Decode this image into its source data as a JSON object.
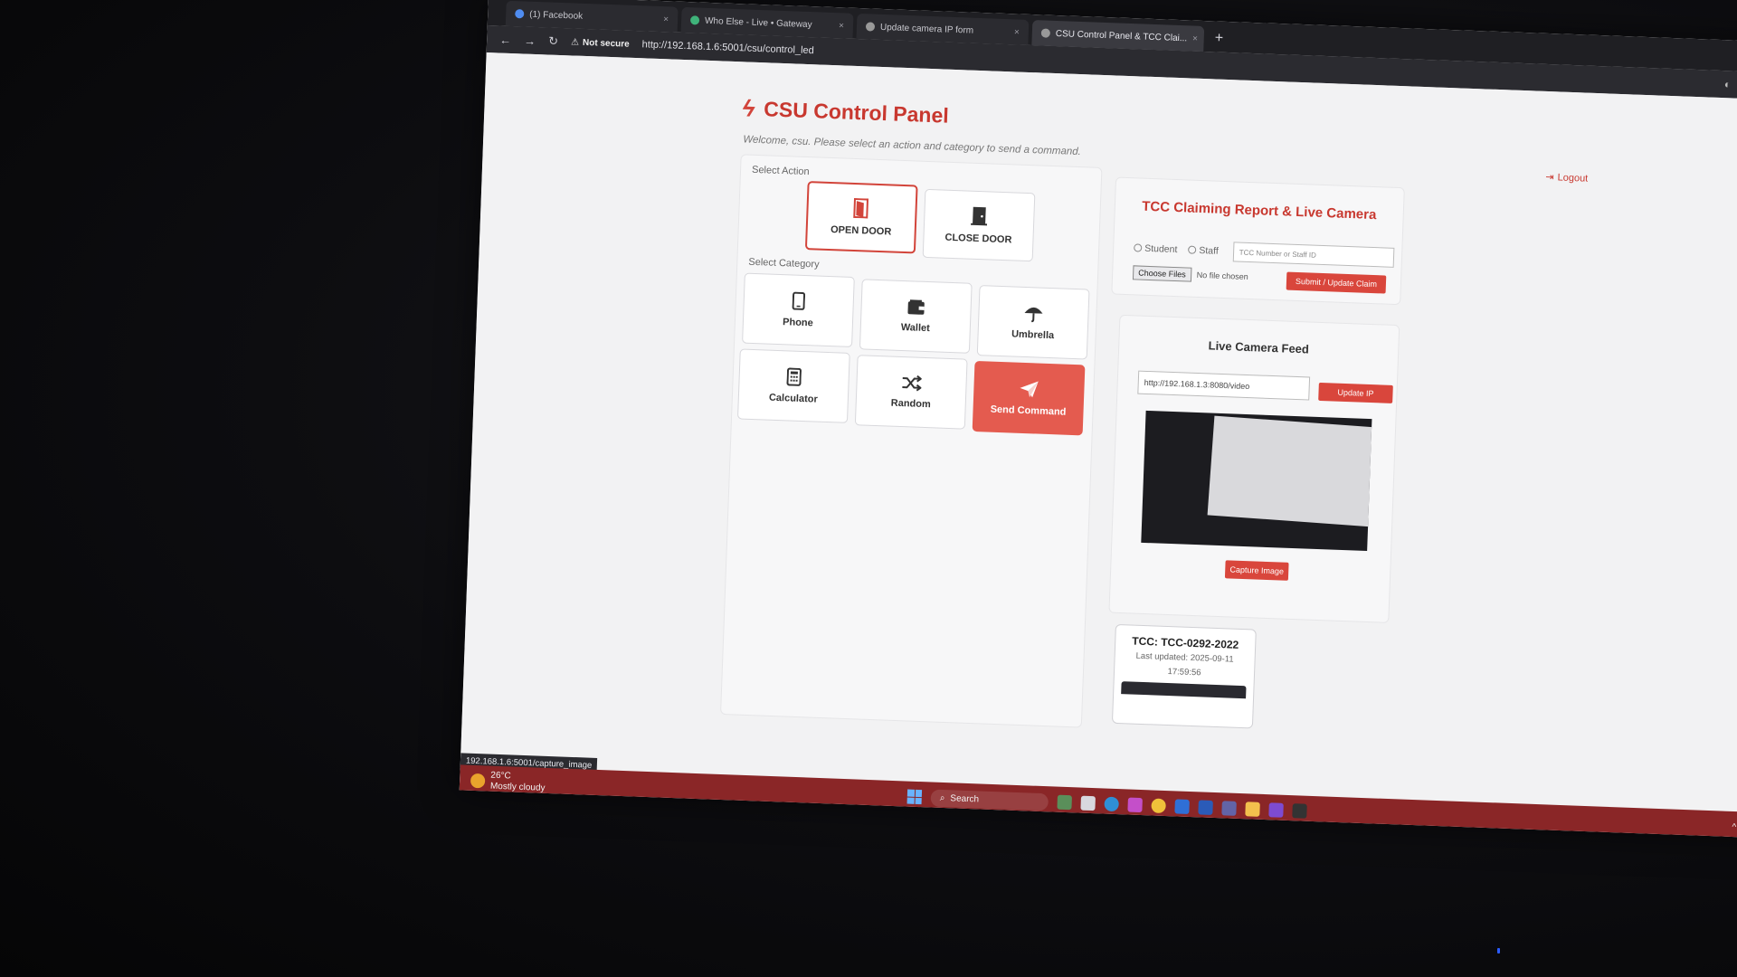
{
  "browser": {
    "tabs": [
      {
        "label": "(1) Facebook"
      },
      {
        "label": "Who Else - Live • Gateway"
      },
      {
        "label": "Update camera IP form"
      },
      {
        "label": "CSU Control Panel & TCC Clai..."
      }
    ],
    "security": "Not secure",
    "url": "http://192.168.1.6:5001/csu/control_led",
    "status_link": "192.168.1.6:5001/capture_image"
  },
  "header": {
    "title": "CSU Control Panel",
    "welcome": "Welcome, csu. Please select an action and category to send a command.",
    "logout": "Logout"
  },
  "actions": {
    "label": "Select Action",
    "open_door": "OPEN DOOR",
    "close_door": "CLOSE DOOR"
  },
  "categories": {
    "label": "Select Category",
    "phone": "Phone",
    "wallet": "Wallet",
    "umbrella": "Umbrella",
    "calculator": "Calculator",
    "random": "Random",
    "send": "Send Command"
  },
  "report": {
    "title": "TCC Claiming Report & Live Camera",
    "student": "Student",
    "staff": "Staff",
    "tcc_placeholder": "TCC Number or Staff ID",
    "choose_files": "Choose Files",
    "no_file": "No file chosen",
    "submit": "Submit / Update Claim"
  },
  "camera": {
    "title": "Live Camera Feed",
    "url": "http://192.168.1.3:8080/video",
    "update_ip": "Update IP",
    "capture": "Capture Image"
  },
  "tcc_card": {
    "id": "TCC: TCC-0292-2022",
    "updated": "Last updated: 2025-09-11",
    "time": "17:59:56"
  },
  "taskbar": {
    "temperature": "26°C",
    "weather": "Mostly cloudy",
    "search": "Search"
  },
  "colors": {
    "accent": "#d2443a",
    "send_button": "#e45b4f",
    "taskbar": "#8a2627"
  }
}
